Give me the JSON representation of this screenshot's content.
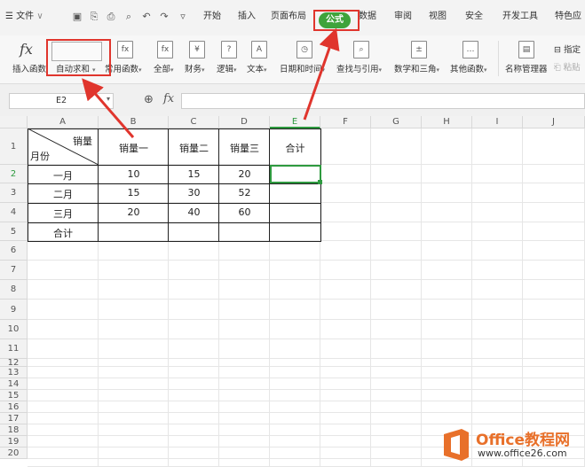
{
  "menubar": {
    "file_label": "文件",
    "tabs": [
      "开始",
      "插入",
      "页面布局",
      "公式",
      "数据",
      "审阅",
      "视图",
      "安全",
      "开发工具",
      "特色应"
    ],
    "active_tab": "公式"
  },
  "ribbon": {
    "buttons": [
      {
        "label": "插入函数",
        "icon": "fx-icon"
      },
      {
        "label": "自动求和",
        "icon": "sigma-icon"
      },
      {
        "label": "常用函数",
        "icon": "function-icon"
      },
      {
        "label": "全部",
        "icon": "fx-all-icon"
      },
      {
        "label": "财务",
        "icon": "finance-icon"
      },
      {
        "label": "逻辑",
        "icon": "logic-icon"
      },
      {
        "label": "文本",
        "icon": "text-icon"
      },
      {
        "label": "日期和时间",
        "icon": "clock-icon"
      },
      {
        "label": "查找与引用",
        "icon": "lookup-icon"
      },
      {
        "label": "数学和三角",
        "icon": "math-icon"
      },
      {
        "label": "其他函数",
        "icon": "more-icon"
      },
      {
        "label": "名称管理器",
        "icon": "name-manager-icon"
      }
    ],
    "side_top": "指定",
    "side_bottom": "粘贴"
  },
  "formula_bar": {
    "name_box": "E2",
    "fx": "fx"
  },
  "sheet": {
    "columns": [
      "A",
      "B",
      "C",
      "D",
      "E",
      "F",
      "G",
      "H",
      "I",
      "J"
    ],
    "rows": [
      "1",
      "2",
      "3",
      "4",
      "5",
      "6",
      "7",
      "8",
      "9",
      "10",
      "11",
      "12",
      "13",
      "14",
      "15",
      "16",
      "17",
      "18",
      "19",
      "20"
    ],
    "diag_top": "销量",
    "diag_bottom": "月份",
    "headers": [
      "销量一",
      "销量二",
      "销量三",
      "合计"
    ],
    "data": [
      [
        "一月",
        "10",
        "15",
        "20",
        ""
      ],
      [
        "二月",
        "15",
        "30",
        "52",
        ""
      ],
      [
        "三月",
        "20",
        "40",
        "60",
        ""
      ],
      [
        "合计",
        "",
        "",
        "",
        ""
      ]
    ]
  },
  "watermark": {
    "brand": "Office教程网",
    "url": "www.office26.com"
  },
  "colors": {
    "accent_green": "#3fa33b",
    "highlight_red": "#e0352d"
  }
}
